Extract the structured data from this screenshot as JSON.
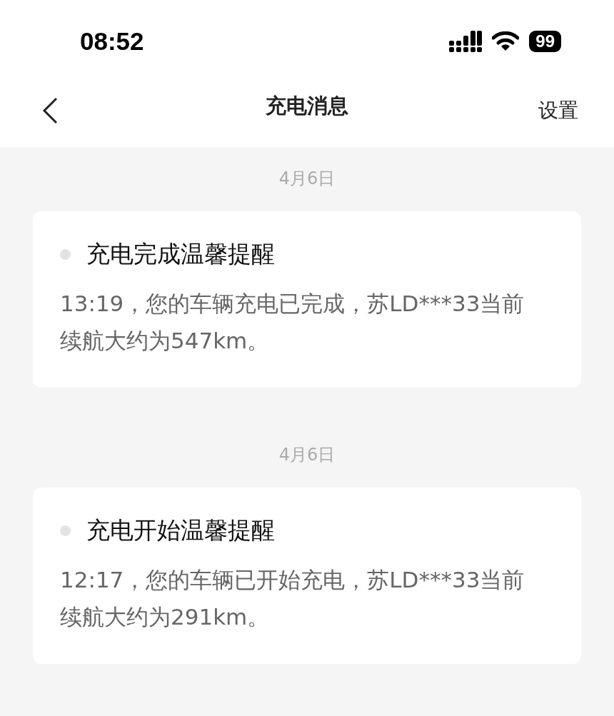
{
  "status_bar": {
    "time": "08:52",
    "battery": "99"
  },
  "nav": {
    "title": "充电消息",
    "action": "设置"
  },
  "messages": [
    {
      "date": "4月6日",
      "title": "充电完成温馨提醒",
      "body": "13:19，您的车辆充电已完成，苏LD***33当前续航大约为547km。"
    },
    {
      "date": "4月6日",
      "title": "充电开始温馨提醒",
      "body": "12:17，您的车辆已开始充电，苏LD***33当前续航大约为291km。"
    }
  ]
}
